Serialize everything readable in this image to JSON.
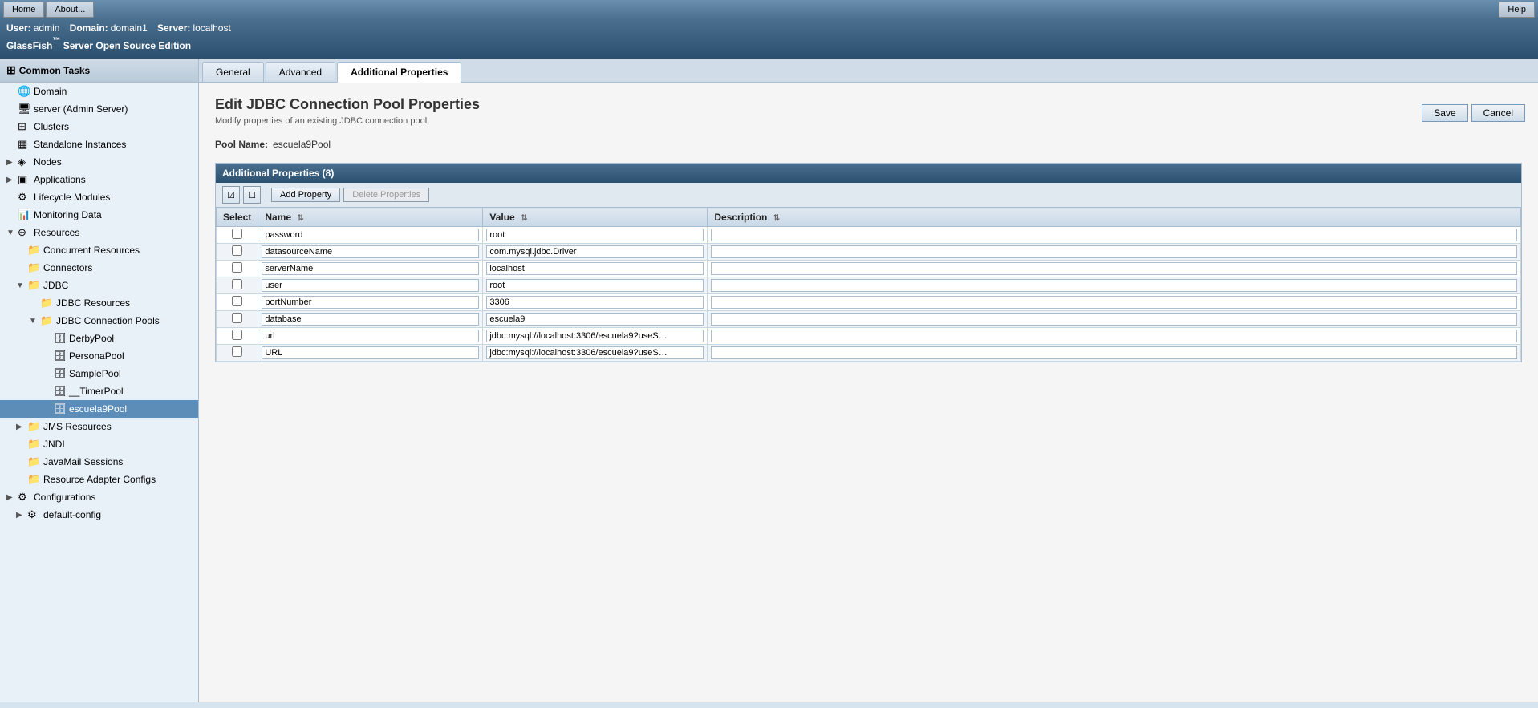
{
  "topbar": {
    "home_label": "Home",
    "about_label": "About...",
    "help_label": "Help"
  },
  "header": {
    "user": "admin",
    "domain": "domain1",
    "server": "localhost",
    "title": "GlassFish",
    "title_super": "™",
    "title_rest": " Server Open Source Edition"
  },
  "sidebar": {
    "header": "Common Tasks",
    "items": [
      {
        "id": "domain",
        "label": "Domain",
        "indent": 1,
        "icon": "globe",
        "expand": ""
      },
      {
        "id": "server",
        "label": "server (Admin Server)",
        "indent": 1,
        "icon": "server",
        "expand": ""
      },
      {
        "id": "clusters",
        "label": "Clusters",
        "indent": 1,
        "icon": "cluster",
        "expand": ""
      },
      {
        "id": "standalone",
        "label": "Standalone Instances",
        "indent": 1,
        "icon": "list",
        "expand": ""
      },
      {
        "id": "nodes",
        "label": "Nodes",
        "indent": 1,
        "icon": "node",
        "expand": "▶"
      },
      {
        "id": "applications",
        "label": "Applications",
        "indent": 1,
        "icon": "app",
        "expand": "▶"
      },
      {
        "id": "lifecycle",
        "label": "Lifecycle Modules",
        "indent": 1,
        "icon": "lifecycle",
        "expand": ""
      },
      {
        "id": "monitoring",
        "label": "Monitoring Data",
        "indent": 1,
        "icon": "monitor",
        "expand": ""
      },
      {
        "id": "resources",
        "label": "Resources",
        "indent": 1,
        "icon": "resource",
        "expand": "▼"
      },
      {
        "id": "concurrent",
        "label": "Concurrent Resources",
        "indent": 2,
        "icon": "folder",
        "expand": ""
      },
      {
        "id": "connectors",
        "label": "Connectors",
        "indent": 2,
        "icon": "folder",
        "expand": ""
      },
      {
        "id": "jdbc",
        "label": "JDBC",
        "indent": 2,
        "icon": "folder",
        "expand": "▼"
      },
      {
        "id": "jdbc-resources",
        "label": "JDBC Resources",
        "indent": 3,
        "icon": "folder",
        "expand": ""
      },
      {
        "id": "jdbc-pools",
        "label": "JDBC Connection Pools",
        "indent": 3,
        "icon": "folder",
        "expand": "▼"
      },
      {
        "id": "derbypool",
        "label": "DerbyPool",
        "indent": 4,
        "icon": "db",
        "expand": ""
      },
      {
        "id": "personapool",
        "label": "PersonaPool",
        "indent": 4,
        "icon": "db",
        "expand": ""
      },
      {
        "id": "samplepool",
        "label": "SamplePool",
        "indent": 4,
        "icon": "db",
        "expand": ""
      },
      {
        "id": "timerpool",
        "label": "__TimerPool",
        "indent": 4,
        "icon": "db",
        "expand": ""
      },
      {
        "id": "escuela9pool",
        "label": "escuela9Pool",
        "indent": 4,
        "icon": "db",
        "expand": "",
        "selected": true
      },
      {
        "id": "jms",
        "label": "JMS Resources",
        "indent": 2,
        "icon": "folder",
        "expand": "▶"
      },
      {
        "id": "jndi",
        "label": "JNDI",
        "indent": 2,
        "icon": "folder",
        "expand": ""
      },
      {
        "id": "javamail",
        "label": "JavaMail Sessions",
        "indent": 2,
        "icon": "folder",
        "expand": ""
      },
      {
        "id": "resource-adapter",
        "label": "Resource Adapter Configs",
        "indent": 2,
        "icon": "folder",
        "expand": ""
      },
      {
        "id": "configurations",
        "label": "Configurations",
        "indent": 1,
        "icon": "config",
        "expand": "▶"
      },
      {
        "id": "default-config",
        "label": "default-config",
        "indent": 2,
        "icon": "config",
        "expand": "▶"
      }
    ]
  },
  "tabs": [
    {
      "id": "general",
      "label": "General",
      "active": false
    },
    {
      "id": "advanced",
      "label": "Advanced",
      "active": false
    },
    {
      "id": "additional",
      "label": "Additional Properties",
      "active": true
    }
  ],
  "page": {
    "title": "Edit JDBC Connection Pool Properties",
    "subtitle": "Modify properties of an existing JDBC connection pool.",
    "pool_name_label": "Pool Name:",
    "pool_name_value": "escuela9Pool",
    "save_label": "Save",
    "cancel_label": "Cancel"
  },
  "properties_table": {
    "header": "Additional Properties (8)",
    "add_property_label": "Add Property",
    "delete_properties_label": "Delete Properties",
    "columns": {
      "select": "Select",
      "name": "Name",
      "value": "Value",
      "description": "Description"
    },
    "rows": [
      {
        "name": "password",
        "value": "root",
        "description": ""
      },
      {
        "name": "datasourceName",
        "value": "com.mysql.jdbc.Driver",
        "description": ""
      },
      {
        "name": "serverName",
        "value": "localhost",
        "description": ""
      },
      {
        "name": "user",
        "value": "root",
        "description": ""
      },
      {
        "name": "portNumber",
        "value": "3306",
        "description": ""
      },
      {
        "name": "database",
        "value": "escuela9",
        "description": ""
      },
      {
        "name": "url",
        "value": "jdbc:mysql://localhost:3306/escuela9?useS…",
        "description": ""
      },
      {
        "name": "URL",
        "value": "jdbc:mysql://localhost:3306/escuela9?useS…",
        "description": ""
      }
    ]
  }
}
